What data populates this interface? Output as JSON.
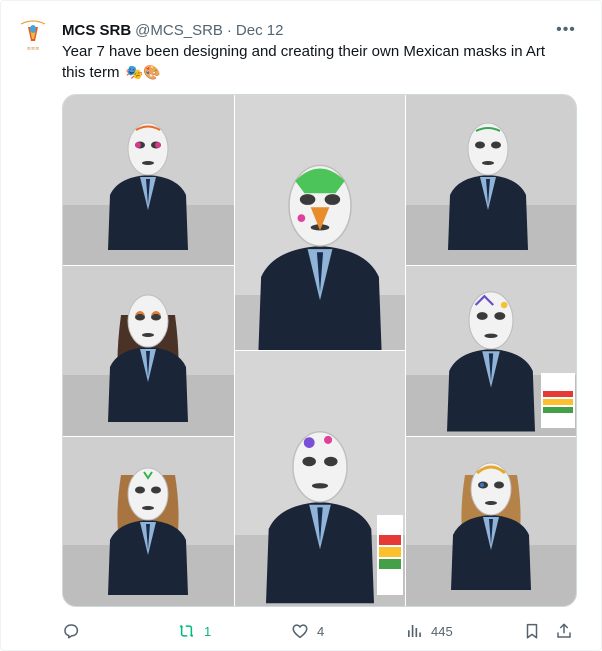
{
  "tweet": {
    "author_name": "MCS SRB",
    "handle": "@MCS_SRB",
    "separator": "·",
    "date": "Dec 12",
    "text": "Year 7 have been designing and creating their own Mexican masks in Art this term",
    "emojis": "🎭🎨",
    "more_label": "•••"
  },
  "actions": {
    "reply_count": "",
    "retweet_count": "1",
    "like_count": "4",
    "views_count": "445"
  },
  "colors": {
    "text_primary": "#0f1419",
    "text_secondary": "#536471",
    "retweet_active": "#00ba7c",
    "blazer": "#1b2538",
    "wall": "#cfcfcf"
  },
  "media": {
    "photo_count": 8
  }
}
